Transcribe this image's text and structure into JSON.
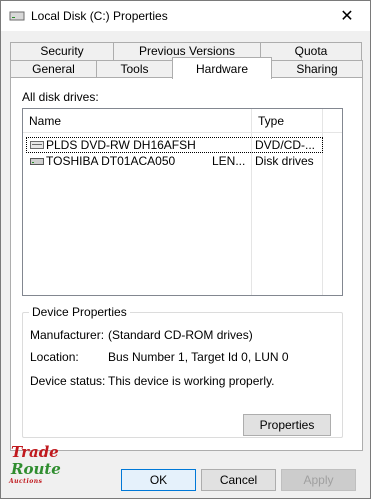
{
  "window": {
    "title": "Local Disk (C:) Properties",
    "close_glyph": "✕"
  },
  "tabs_top": [
    "Security",
    "Previous Versions",
    "Quota"
  ],
  "tabs_bottom": [
    "General",
    "Tools",
    "Hardware",
    "Sharing"
  ],
  "active_tab": "Hardware",
  "drives_label": "All disk drives:",
  "columns": {
    "name": "Name",
    "type": "Type"
  },
  "drives": [
    {
      "name": "PLDS DVD-RW DH16AFSH",
      "extra": "",
      "type": "DVD/CD-..."
    },
    {
      "name": "TOSHIBA DT01ACA050",
      "extra": "LEN...",
      "type": "Disk drives"
    }
  ],
  "device_properties": {
    "title": "Device Properties",
    "manufacturer_label": "Manufacturer:",
    "manufacturer_value": "(Standard CD-ROM drives)",
    "location_label": "Location:",
    "location_value": "Bus Number 1, Target Id 0, LUN 0",
    "status_label": "Device status:",
    "status_value": "This device is working properly.",
    "properties_button": "Properties"
  },
  "buttons": {
    "ok": "OK",
    "cancel": "Cancel",
    "apply": "Apply"
  },
  "logo": {
    "line1": "Trade",
    "line2": "Route",
    "line3": "Auctions"
  },
  "colors": {
    "accent": "#0078d7",
    "logo_red": "#c0181d",
    "logo_green": "#2f8d2f"
  }
}
